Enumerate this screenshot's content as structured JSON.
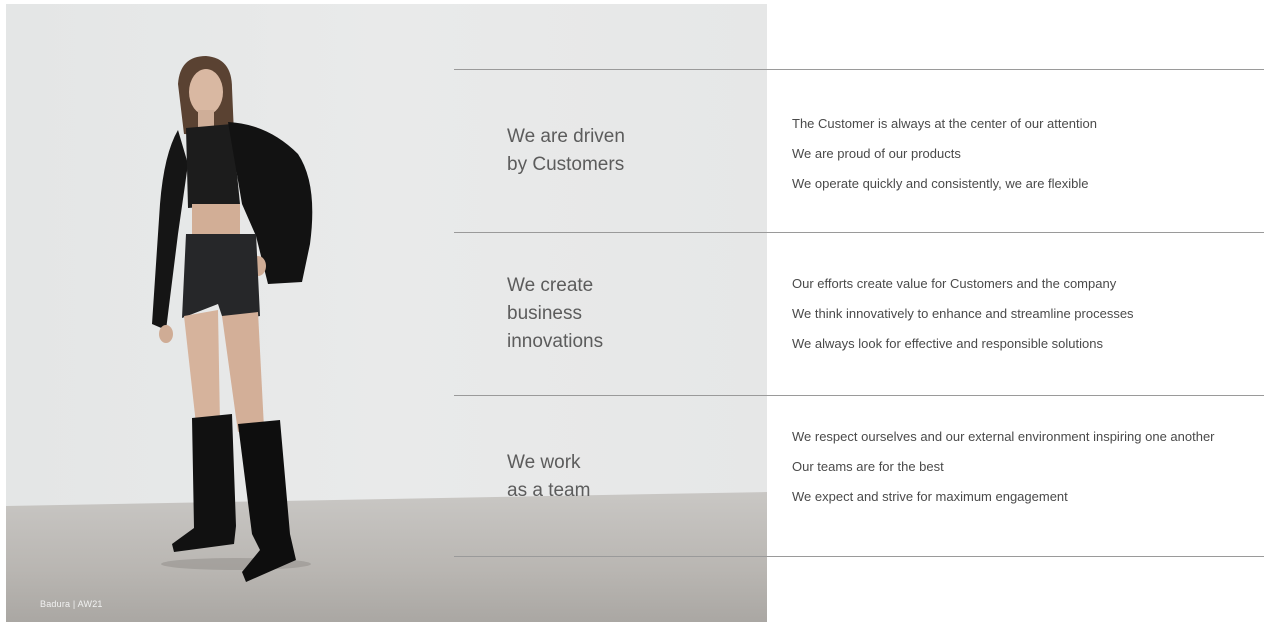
{
  "caption": "Badura | AW21",
  "sections": [
    {
      "heading": "We are driven\nby Customers",
      "items": [
        "The Customer is always at the center of our attention",
        "We are proud of our products",
        "We operate quickly and consistently, we are flexible"
      ]
    },
    {
      "heading": "We create\nbusiness\ninnovations",
      "items": [
        "Our efforts create value for Customers and the company",
        "We think innovatively to enhance and streamline processes",
        "We always look for effective and responsible solutions"
      ]
    },
    {
      "heading": "We work\nas a team",
      "items": [
        "We respect ourselves and our external environment inspiring one another",
        "Our teams are for the best",
        "We expect and strive for maximum engagement"
      ]
    }
  ]
}
